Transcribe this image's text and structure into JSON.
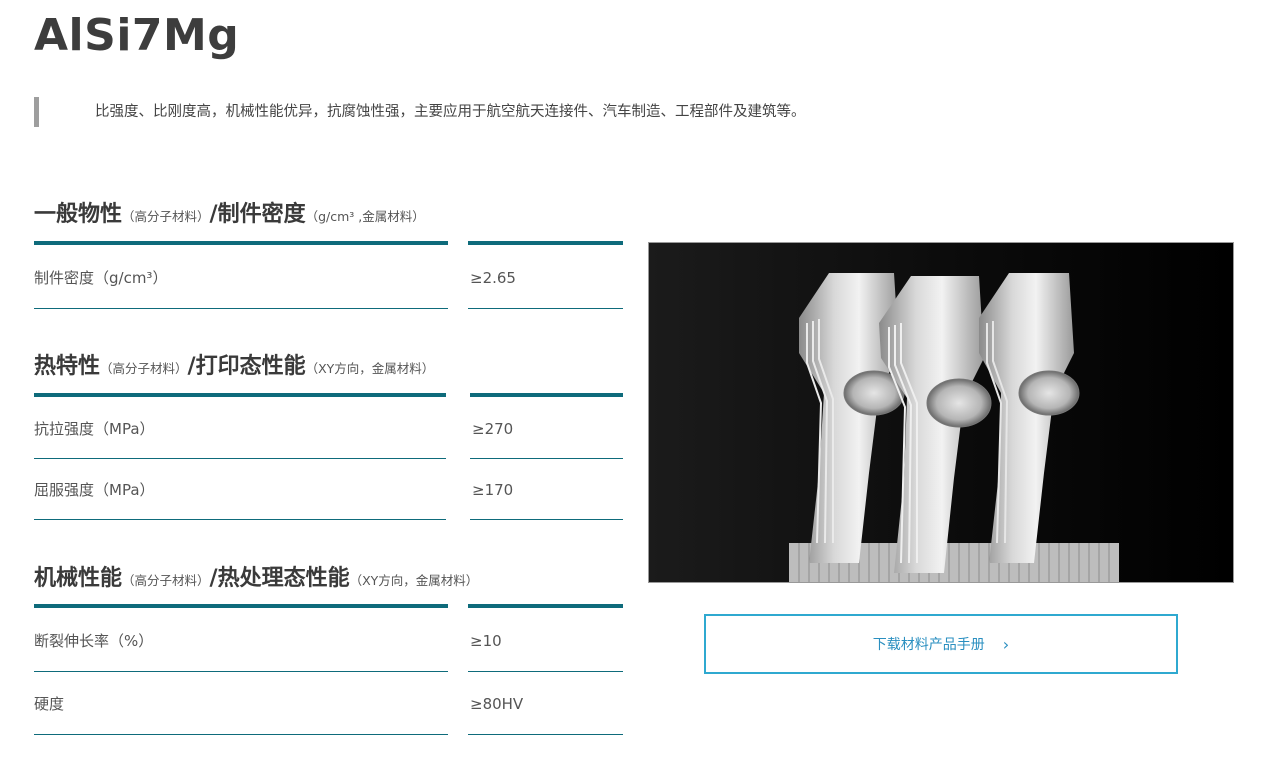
{
  "title": "AlSi7Mg",
  "description": "比强度、比刚度高，机械性能优异，抗腐蚀性强，主要应用于航空航天连接件、汽车制造、工程部件及建筑等。",
  "sections": [
    {
      "head": "一般物性",
      "head_small": "（高分子材料）",
      "head2": "/制件密度",
      "head2_small": "（g/cm³ ,金属材料）",
      "rows": [
        {
          "label": "制件密度（g/cm³）",
          "value": "≥2.65"
        }
      ]
    },
    {
      "head": "热特性",
      "head_small": "（高分子材料）",
      "head2": "/打印态性能",
      "head2_small": "（XY方向，金属材料）",
      "rows": [
        {
          "label": "抗拉强度（MPa）",
          "value": "≥270"
        },
        {
          "label": "屈服强度（MPa）",
          "value": "≥170"
        }
      ]
    },
    {
      "head": "机械性能",
      "head_small": "（高分子材料）",
      "head2": "/热处理态性能",
      "head2_small": "（XY方向，金属材料）",
      "rows": [
        {
          "label": "断裂伸长率（%）",
          "value": "≥10"
        },
        {
          "label": "硬度",
          "value": "≥80HV"
        }
      ]
    }
  ],
  "download": {
    "label": "下载材料产品手册",
    "chevron": "›"
  },
  "colors": {
    "accent_bar": "#0e6b7b",
    "button_border": "#2fa9d0",
    "button_text": "#2a8fc0"
  }
}
